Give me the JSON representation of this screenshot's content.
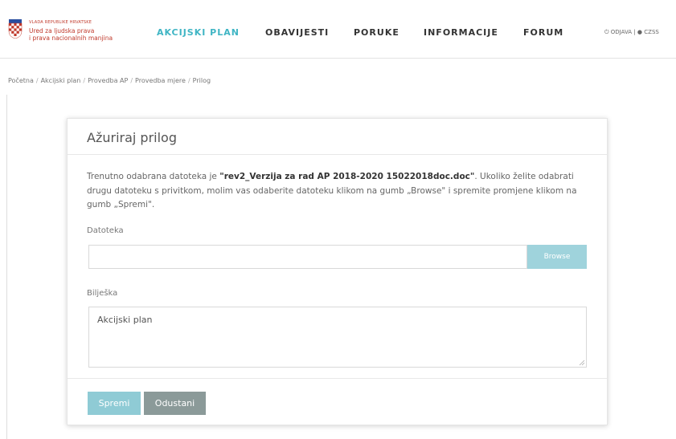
{
  "logo": {
    "line1": "VLADA REPUBLIKE HRVATSKE",
    "line2": "Ured za ljudska prava",
    "line3": "i prava nacionalnih manjina"
  },
  "nav": {
    "items": [
      {
        "label": "AKCIJSKI PLAN",
        "active": true
      },
      {
        "label": "OBAVIJESTI",
        "active": false
      },
      {
        "label": "PORUKE",
        "active": false
      },
      {
        "label": "INFORMACIJE",
        "active": false
      },
      {
        "label": "FORUM",
        "active": false
      }
    ]
  },
  "user_area": {
    "logout": "ODJAVA",
    "user": "CZSS"
  },
  "breadcrumb": [
    "Početna",
    "Akcijski plan",
    "Provedba AP",
    "Provedba mjere",
    "Prilog"
  ],
  "form": {
    "title": "Ažuriraj prilog",
    "description_prefix": "Trenutno odabrana datoteka je ",
    "file_name": "\"rev2_Verzija za rad AP 2018-2020 15022018doc.doc\"",
    "description_suffix": ". Ukoliko želite odabrati drugu datoteku s privitkom, molim vas odaberite datoteku klikom na gumb „Browse\" i spremite promjene klikom na gumb „Spremi\".",
    "file_label": "Datoteka",
    "file_value": "",
    "browse_label": "Browse",
    "note_label": "Bilješka",
    "note_value": "Akcijski plan",
    "save_label": "Spremi",
    "cancel_label": "Odustani"
  },
  "colors": {
    "accent": "#3fb5c4",
    "browse": "#9fd3dc",
    "save": "#8fcbd5",
    "cancel": "#8b9a99",
    "brand_red": "#c0392b"
  }
}
